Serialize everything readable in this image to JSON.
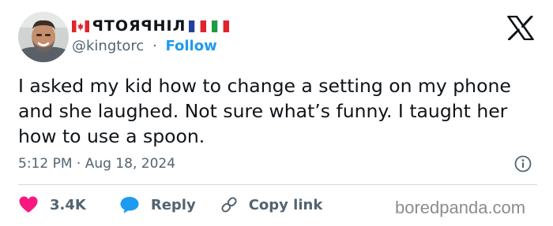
{
  "tweet": {
    "author": {
      "display_name": "ꟼTOЯꟼHIЛ",
      "handle": "@kingtorc",
      "separator": "·",
      "follow_label": "Follow",
      "flags": [
        "canada-flag",
        "france-flag",
        "italy-flag"
      ]
    },
    "text": "I asked my kid how to change a setting on my phone and she laughed. Not sure what’s funny. I taught her how to use a spoon.",
    "timestamp": "5:12 PM · Aug 18, 2024",
    "actions": {
      "like_count": "3.4K",
      "reply_label": "Reply",
      "copy_link_label": "Copy link"
    },
    "icons": [
      "x-logo-icon",
      "info-icon",
      "heart-icon",
      "reply-bubble-icon",
      "link-icon"
    ]
  },
  "colors": {
    "text": "#0f1419",
    "secondary": "#536471",
    "follow": "#1d9bf0",
    "like": "#f91880",
    "reply": "#1d9bf0",
    "divider": "#cfd9de"
  },
  "watermark": "boredpanda.com"
}
